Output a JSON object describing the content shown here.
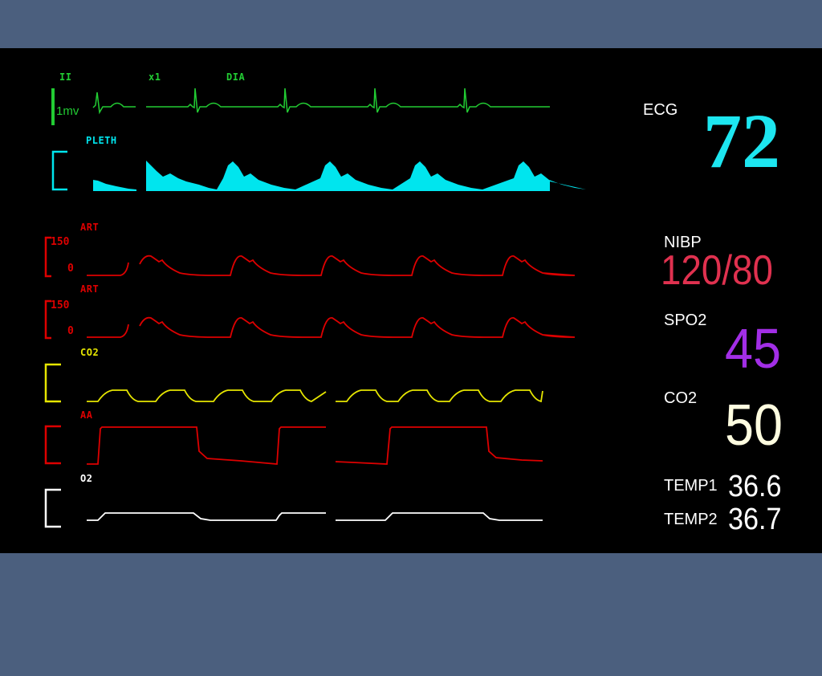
{
  "colors": {
    "frame": "#4b5f7e",
    "screen": "#000000",
    "ecg": "#22cc33",
    "pleth": "#00e5ee",
    "art": "#dd0000",
    "co2": "#e6e600",
    "aa": "#dd0000",
    "o2": "#ffffff",
    "hr_value": "#1de6f0",
    "nibp_value": "#e0314f",
    "spo2_value": "#a22ee6",
    "co2_value": "#fffde0",
    "temp_value": "#ffffff"
  },
  "waveforms": {
    "ecg": {
      "lead": "II",
      "gain": "x1",
      "mode": "DIA",
      "scale": "1mv"
    },
    "pleth": {
      "label": "PLETH"
    },
    "art1": {
      "label": "ART",
      "scale_top": "150",
      "scale_bottom": "0"
    },
    "art2": {
      "label": "ART",
      "scale_top": "150",
      "scale_bottom": "0"
    },
    "co2": {
      "label": "CO2"
    },
    "aa": {
      "label": "AA"
    },
    "o2": {
      "label": "O2"
    }
  },
  "parameters": {
    "ecg": {
      "label": "ECG",
      "value": "72"
    },
    "nibp": {
      "label": "NIBP",
      "value": "120/80"
    },
    "spo2": {
      "label": "SPO2",
      "value": "45"
    },
    "co2": {
      "label": "CO2",
      "value": "50"
    },
    "temp1": {
      "label": "TEMP1",
      "value": "36.6"
    },
    "temp2": {
      "label": "TEMP2",
      "value": "36.7"
    }
  }
}
